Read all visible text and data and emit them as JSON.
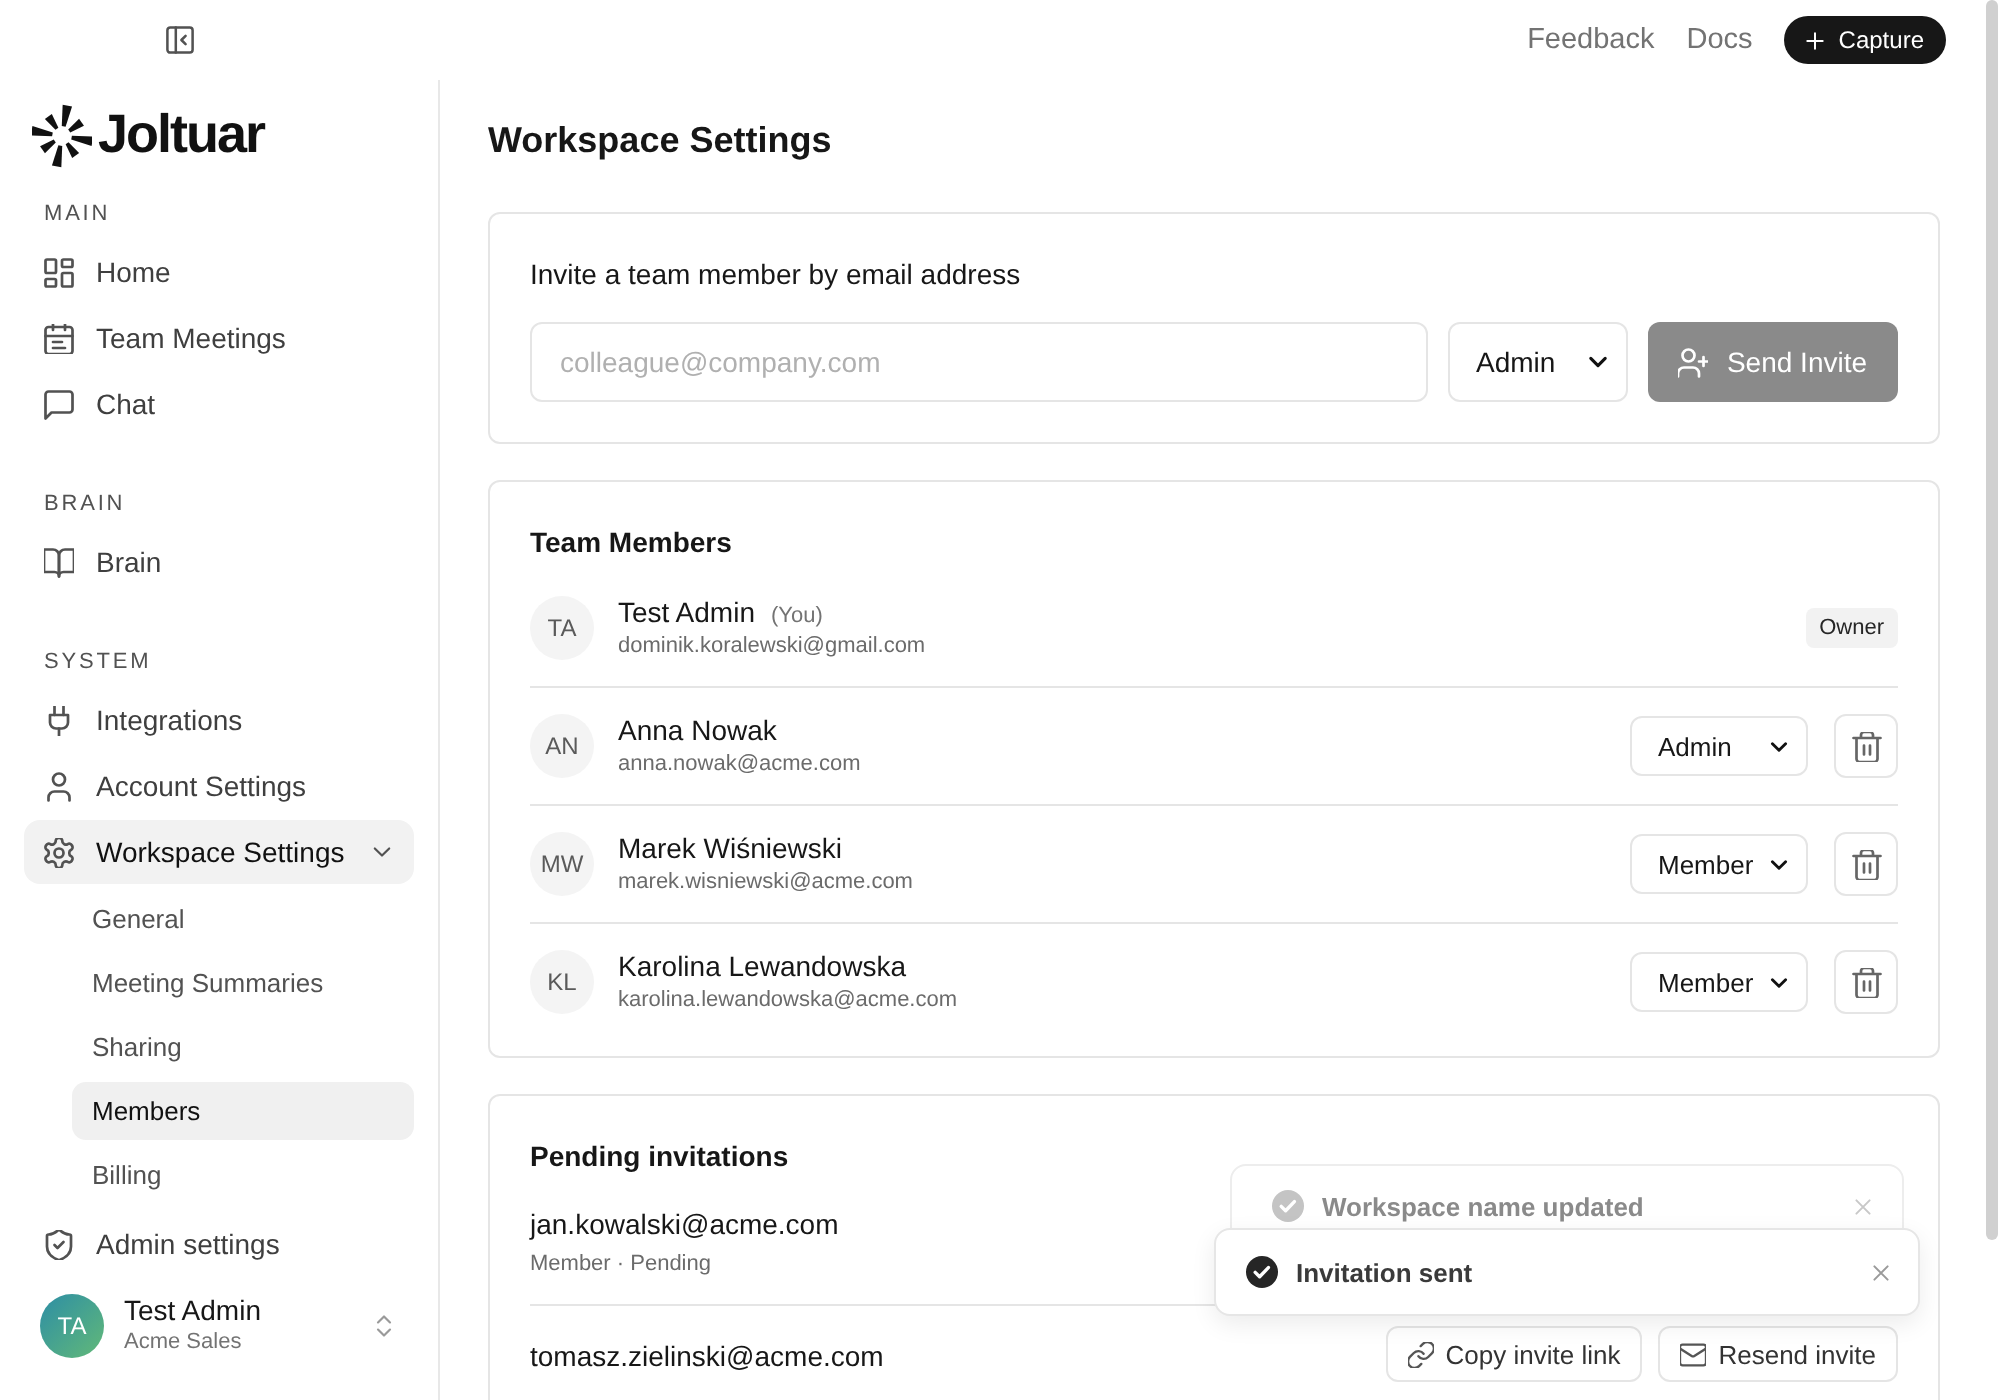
{
  "top_bar": {
    "links": [
      "Feedback",
      "Docs"
    ],
    "capture_button": "Capture"
  },
  "sidebar": {
    "brand": "Joltuar",
    "sections": [
      {
        "heading": "MAIN",
        "items": [
          {
            "label": "Home",
            "selected": false
          },
          {
            "label": "Team Meetings",
            "selected": false
          },
          {
            "label": "Chat",
            "selected": false
          }
        ]
      },
      {
        "heading": "BRAIN",
        "items": [
          {
            "label": "Brain",
            "selected": false
          }
        ]
      },
      {
        "heading": "SYSTEM",
        "items": [
          {
            "label": "Integrations",
            "selected": false
          },
          {
            "label": "Account Settings",
            "selected": false
          },
          {
            "label": "Workspace Settings",
            "selected": true,
            "expanded": true,
            "children": [
              {
                "label": "General",
                "selected": false
              },
              {
                "label": "Meeting Summaries",
                "selected": false
              },
              {
                "label": "Sharing",
                "selected": false
              },
              {
                "label": "Members",
                "selected": true
              },
              {
                "label": "Billing",
                "selected": false
              }
            ]
          },
          {
            "label": "Admin settings",
            "selected": false
          }
        ]
      }
    ],
    "user": {
      "initials": "TA",
      "name": "Test Admin",
      "organization": "Acme Sales"
    }
  },
  "page": {
    "title": "Workspace Settings",
    "invite": {
      "heading": "Invite a team member by email address",
      "email_field": {
        "placeholder": "colleague@company.com"
      },
      "role_select": "Admin",
      "send_button": {
        "label": "Send Invite",
        "disabled": true
      }
    },
    "team_members": {
      "heading": "Team Members",
      "members": [
        {
          "kind": "owner",
          "initials": "TA",
          "name": "Test Admin",
          "note": "(You)",
          "email": "dominik.koralewski@gmail.com",
          "badge": "Owner"
        },
        {
          "kind": "editable",
          "initials": "AN",
          "name": "Anna Nowak",
          "email": "anna.nowak@acme.com",
          "role": "Admin"
        },
        {
          "kind": "editable",
          "initials": "MW",
          "name": "Marek Wiśniewski",
          "email": "marek.wisniewski@acme.com",
          "role": "Member"
        },
        {
          "kind": "editable",
          "initials": "KL",
          "name": "Karolina Lewandowska",
          "email": "karolina.lewandowska@acme.com",
          "role": "Member"
        }
      ]
    },
    "pending_invitations": {
      "heading": "Pending invitations",
      "invites": [
        {
          "email": "jan.kowalski@acme.com",
          "status": "Member · Pending"
        },
        {
          "email": "tomasz.zielinski@acme.com",
          "actions": [
            "Copy invite link",
            "Resend invite"
          ]
        }
      ]
    }
  },
  "toasts": [
    {
      "kind": "background",
      "message": "Workspace name updated"
    },
    {
      "kind": "foreground",
      "message": "Invitation sent"
    }
  ]
}
